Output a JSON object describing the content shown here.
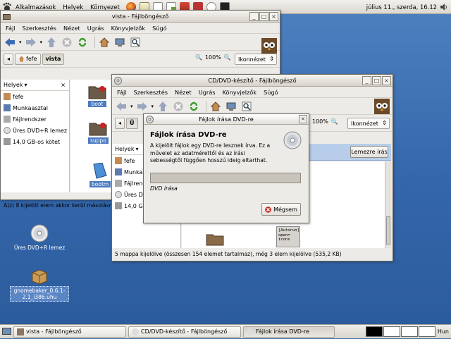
{
  "top_panel": {
    "menus": [
      "Alkalmazások",
      "Helyek",
      "Környezet"
    ],
    "clock": "július 11., szerda, 16.12"
  },
  "desktop": {
    "icons": [
      {
        "label": "Üres DVD+R lemez",
        "icon": "dvd-disc-icon"
      },
      {
        "label": "gnomebaker_0.6.1-2.1_i386.uhu",
        "icon": "package-icon"
      }
    ]
  },
  "win_vista": {
    "title": "vista - Fájlböngésző",
    "menus": [
      "Fájl",
      "Szerkesztés",
      "Nézet",
      "Ugrás",
      "Könyvjelzők",
      "Súgó"
    ],
    "path": [
      "fefe",
      "vista"
    ],
    "zoom": "100%",
    "view": "Ikonnézet",
    "sidebar_title": "Helyek",
    "places": [
      "fefe",
      "Munkaasztal",
      "Fájlrendszer",
      "Üres DVD+R lemez",
      "14,0 GB-os kötet"
    ],
    "items": [
      "boot",
      "suppo",
      "bootm"
    ],
    "status": "A(z) 8 kijelölt elem akkor kerül másolásra, ha kiv..."
  },
  "win_cd": {
    "title": "CD/DVD-készítő - Fájlböngésző",
    "menus": [
      "Fájl",
      "Szerkesztés",
      "Nézet",
      "Ugrás",
      "Könyvjelzők",
      "Súgó"
    ],
    "zoom": "100%",
    "view": "Ikonnézet",
    "location_partial": "Ü",
    "sidebar_title": "Helyek",
    "places": [
      "fefe",
      "Munkaa",
      "Fájlrend",
      "Üres DV",
      "14,0 GB"
    ],
    "burn_button": "Lemezre írás",
    "autorun_text": "[Autorun]\nopen=\nicons",
    "status": "5 mappa kijelölve (összesen 154 elemet tartalmaz), még 3 elem kijelölve (535,2 KB)"
  },
  "dialog": {
    "title": "Fájlok írása DVD-re",
    "heading": "Fájlok írása DVD-re",
    "text": "A kijelölt fájlok egy DVD-re lesznek írva. Ez a művelet az adatmérettől és az írási sebességtől függően hosszú ideig eltarthat.",
    "progress": 0,
    "status": "DVD írása",
    "cancel": "Mégsem"
  },
  "taskbar": {
    "tasks": [
      "vista - Fájlböngésző",
      "CD/DVD-készítő - Fájlböngésző",
      "Fájlok írása DVD-re"
    ],
    "keyboard": "Hun"
  },
  "colors": {
    "desktop": "#3a6ea5",
    "selection": "#4b7bc0",
    "progress_trough": "#c9c4bb"
  }
}
